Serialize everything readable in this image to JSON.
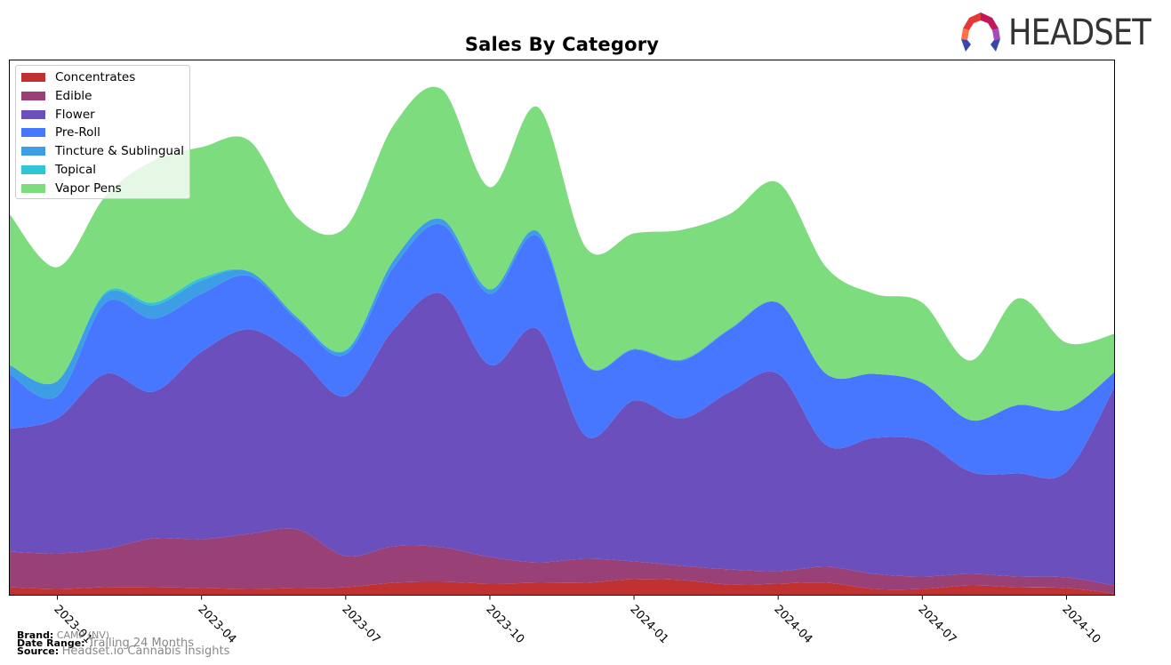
{
  "chart_data": {
    "type": "area",
    "stacked": true,
    "title": "Sales By Category",
    "xlabel": "",
    "ylabel": "",
    "y_axis_labels_shown": false,
    "ylim": [
      0,
      60.2
    ],
    "x": [
      "2022-12",
      "2023-01",
      "2023-02",
      "2023-03",
      "2023-04",
      "2023-05",
      "2023-06",
      "2023-07",
      "2023-08",
      "2023-09",
      "2023-10",
      "2023-11",
      "2023-12",
      "2024-01",
      "2024-02",
      "2024-03",
      "2024-04",
      "2024-05",
      "2024-06",
      "2024-07",
      "2024-08",
      "2024-09",
      "2024-10",
      "2024-11"
    ],
    "x_tick_labels": [
      "2023-01",
      "2023-04",
      "2023-07",
      "2023-10",
      "2024-01",
      "2024-04",
      "2024-07",
      "2024-10"
    ],
    "legend_position": "top-left",
    "grid": false,
    "series": [
      {
        "name": "Concentrates",
        "color": "#c03232",
        "values": [
          0.9,
          0.7,
          0.9,
          0.9,
          0.8,
          0.7,
          0.8,
          0.9,
          1.4,
          1.5,
          1.3,
          1.4,
          1.4,
          1.8,
          1.7,
          1.2,
          1.3,
          1.4,
          0.7,
          0.7,
          1.1,
          0.9,
          0.8,
          0.2
        ]
      },
      {
        "name": "Edible",
        "color": "#994077",
        "values": [
          4.0,
          4.0,
          4.3,
          5.5,
          5.5,
          6.2,
          6.6,
          3.5,
          4.1,
          3.9,
          3.0,
          2.3,
          2.7,
          2.0,
          1.6,
          1.7,
          1.4,
          1.8,
          1.7,
          1.4,
          1.3,
          1.2,
          1.2,
          0.9
        ]
      },
      {
        "name": "Flower",
        "color": "#6a4fbd",
        "values": [
          13.8,
          15.2,
          19.7,
          16.5,
          21.1,
          23.0,
          19.5,
          18.0,
          24.4,
          28.5,
          21.6,
          26.2,
          13.8,
          18.1,
          16.6,
          20.0,
          22.2,
          13.7,
          15.3,
          15.3,
          11.5,
          11.6,
          11.9,
          22.3
        ]
      },
      {
        "name": "Pre-Roll",
        "color": "#4777ff",
        "values": [
          6.2,
          2.5,
          8.0,
          8.2,
          6.5,
          6.0,
          4.0,
          4.7,
          7.0,
          7.8,
          8.0,
          10.5,
          8.0,
          5.7,
          6.5,
          7.0,
          8.0,
          8.0,
          7.2,
          6.5,
          5.8,
          7.7,
          7.0,
          1.7
        ]
      },
      {
        "name": "Tincture & Sublingual",
        "color": "#3d9ee6",
        "values": [
          1.0,
          1.7,
          1.0,
          1.5,
          1.5,
          0.5,
          0.3,
          0.4,
          0.8,
          0.6,
          0.5,
          0.5,
          0.1,
          0.1,
          0.1,
          0.1,
          0,
          0,
          0,
          0,
          0,
          0,
          0,
          0
        ]
      },
      {
        "name": "Topical",
        "color": "#31c4d4",
        "values": [
          0,
          0,
          0.2,
          0.3,
          0.3,
          0,
          0,
          0.1,
          0,
          0,
          0,
          0,
          0,
          0,
          0,
          0,
          0,
          0,
          0,
          0,
          0,
          0,
          0,
          0
        ]
      },
      {
        "name": "Vapor Pens",
        "color": "#7ddc7d",
        "values": [
          17.0,
          12.8,
          10.8,
          16.0,
          14.7,
          14.7,
          11.2,
          13.8,
          15.2,
          14.6,
          11.5,
          14.0,
          13.1,
          13.0,
          14.6,
          12.9,
          13.5,
          12.0,
          9.0,
          9.0,
          6.7,
          12.0,
          7.5,
          4.3
        ]
      }
    ]
  },
  "branding": {
    "logo_text": "HEADSET",
    "logo_icon": "headset-logo-icon"
  },
  "footer": {
    "brand_label": "Brand:",
    "brand_value": "CAMP (NV)",
    "date_range_label": "Date Range:",
    "date_range_value": "Trailing 24 Months",
    "source_label": "Source:",
    "source_value": "Headset.io Cannabis Insights"
  }
}
